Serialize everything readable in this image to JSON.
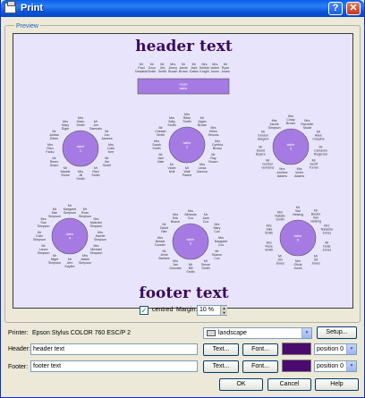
{
  "window": {
    "title": "Print",
    "help_glyph": "?",
    "close_glyph": "✕"
  },
  "preview": {
    "group_label": "Preview",
    "header_text": "header text",
    "footer_text": "footer text",
    "head_table_label": "head\ntable",
    "head_guests": [
      "Mr Paul Nowakle",
      "Mr Ozzo Smith",
      "Mr Jed Smith",
      "Mrs Jenny Brown",
      "Mr Jamie Brown",
      "Mr Jack Gatiss",
      "Mrs Debbie Knight",
      "Mrs Isobel Jones",
      "Mr Ryan Jones"
    ],
    "tables": [
      {
        "label": "table\n1",
        "guests": [
          "Mrs Gaen Smith",
          "Mr Jon Samuels",
          "Mr Jon Jamess",
          "Mrs Colin Kerr",
          "Mr Jim Smith",
          "Mr Ravi Smith",
          "Mrs Jill Smith",
          "Mr Madds Shore",
          "Mr Reem Sharn",
          "Mrs Rico Farku",
          "Mr Adrian Eiken",
          "Mrs Mary Dlgtn"
        ]
      },
      {
        "label": "table\n2",
        "guests": [
          "Mrs Ritee Smith",
          "Mr Algan Brown",
          "Mrs Helen Simons",
          "Mrs Cynthia Brown",
          "Mr Ray Brown",
          "Mrs Linda Gannon",
          "Mr Walt Parker",
          "Mr Violet Mull",
          "Mr Jam Hale",
          "Mrs Sarah Smith",
          "Mr Chester Smith",
          "Mrs Sally Smith"
        ]
      },
      {
        "label": "table\n3",
        "guests": [
          "Mrs Cindy Brown",
          "Mrs Rachelie Stuart",
          "Mr Ailee Crispina",
          "Mr Cameron Rogerson",
          "Mr Geoff Turner",
          "Mrs Victor Adams",
          "Mrs Andrew Adams",
          "Mr Gordon Gordons",
          "Mr David Bryers",
          "Mr Gordon Sargent",
          "Mrs Jackie Simpson"
        ]
      },
      {
        "label": "table\n4",
        "guests": [
          "Mr Margaret Simpson",
          "Mr Ross Simpson",
          "Mrs Malcolm Simpson",
          "Mrs Harriet Simpson",
          "Mrs Michael Simpson",
          "Mrs Jackie Simpson",
          "Mr Jem Kaylee",
          "Mr Nigel Simpson",
          "Mr Lance Simpson",
          "Mr Colin Simpson",
          "Mrs Sue Simpson",
          "Mr Dan Simpson"
        ]
      },
      {
        "label": "table\n5",
        "guests": [
          "Mrs Miranda Cox",
          "Mr Jack Cox",
          "Mrs Mary Cox",
          "Mrs Margaret Cox",
          "Mr Sharon Cox",
          "Mr Simon Smith",
          "Mr Bill Smith",
          "Mrs Jan Gonzalo",
          "Mr Jenie Bankes",
          "Mrs Bessie Dunner",
          "Mr David Bier",
          "Mrs Erik Bosch"
        ]
      },
      {
        "label": "table\n6",
        "guests": [
          "Mr Van Helsing",
          "Mr Buster Van Helsing",
          "Mrs Natasha Jones",
          "Mr Delia Jones",
          "Mr Gil Jones",
          "Mrs Olivia Jones",
          "Mr Jim Jones",
          "Mrs Rose Smith",
          "Mrs Julie Smith",
          "Mrs Natalie Smith"
        ]
      }
    ]
  },
  "options": {
    "centred_label": "centred",
    "centred_checked": true,
    "margin_label": "Margin:",
    "margin_value": "10 %"
  },
  "printer": {
    "label": "Printer:",
    "name": "Epson Stylus COLOR 760 ESC/P 2",
    "orientation": "landscape",
    "setup_button": "Setup..."
  },
  "header_row": {
    "label": "Header:",
    "value": "header text",
    "text_button": "Text...",
    "font_button": "Font...",
    "position": "position 0"
  },
  "footer_row": {
    "label": "Footer:",
    "value": "footer text",
    "text_button": "Text...",
    "font_button": "Font...",
    "position": "position 0"
  },
  "buttons": {
    "ok": "OK",
    "cancel": "Cancel",
    "help": "Help"
  },
  "colors": {
    "title_text": "#3a0a5e",
    "table_fill": "#a57be3",
    "swatch": "#4a0a6e",
    "page_bg": "#e8e4fb"
  }
}
